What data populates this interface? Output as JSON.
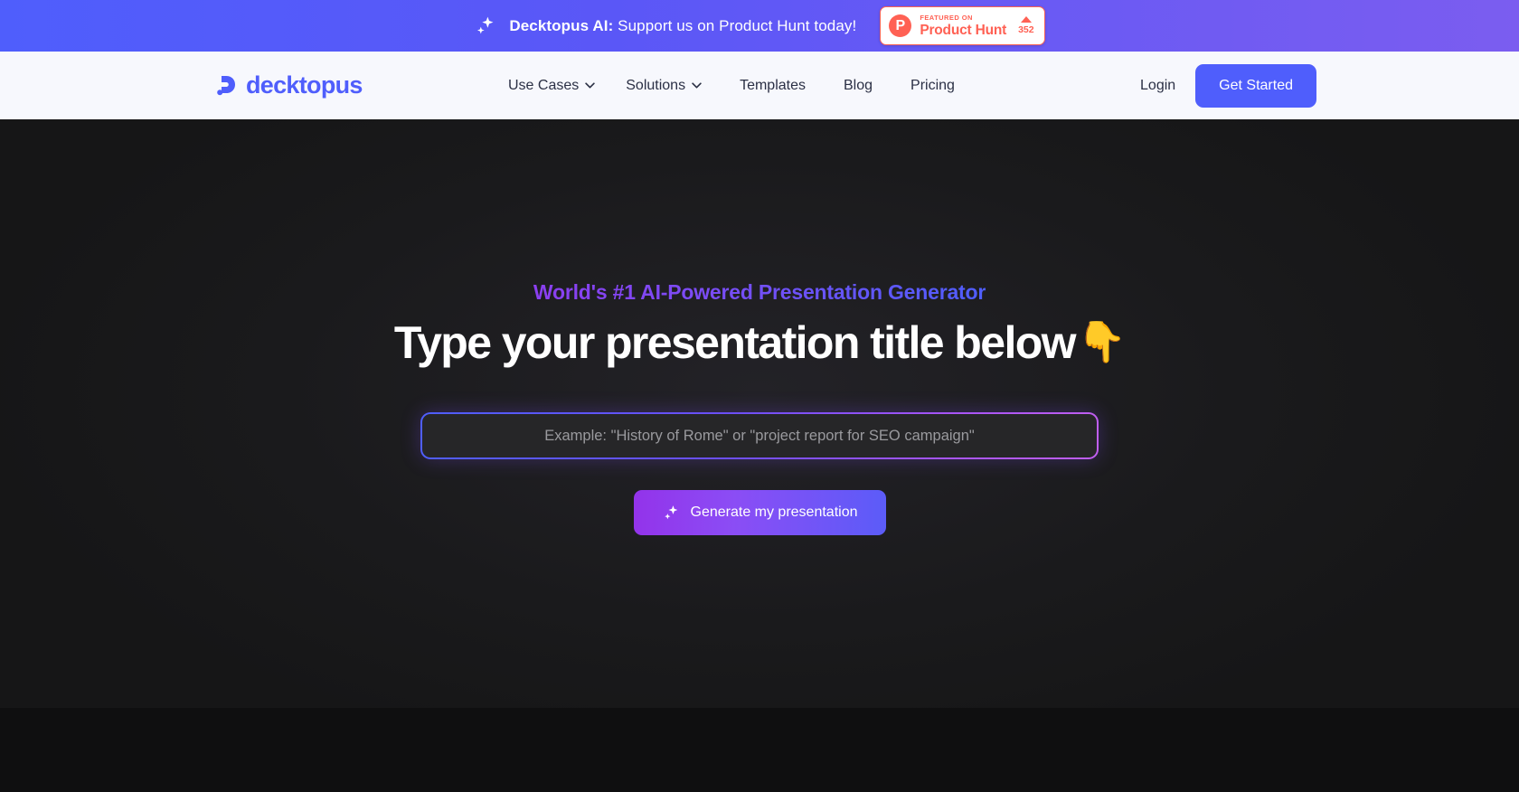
{
  "banner": {
    "sparkle_icon": "sparkle-icon",
    "brand": "Decktopus AI:",
    "message": "Support us on Product Hunt today!",
    "product_hunt": {
      "logo_letter": "P",
      "featured_label": "FEATURED ON",
      "name": "Product Hunt",
      "upvote_icon": "triangle-up-icon",
      "upvote_count": "352",
      "accent_color": "#ff6154"
    },
    "background_color": "#5a57f7"
  },
  "nav": {
    "logo": {
      "icon": "decktopus-logo-icon",
      "text": "decktopus",
      "color": "#4f5efc"
    },
    "links": [
      {
        "label": "Use Cases",
        "has_dropdown": true
      },
      {
        "label": "Solutions",
        "has_dropdown": true
      },
      {
        "label": "Templates",
        "has_dropdown": false
      },
      {
        "label": "Blog",
        "has_dropdown": false
      },
      {
        "label": "Pricing",
        "has_dropdown": false
      }
    ],
    "login_label": "Login",
    "get_started_label": "Get Started",
    "background_color": "#f7f8fd",
    "button_color": "#4f5efc"
  },
  "hero": {
    "eyebrow": "World's #1 AI-Powered Presentation Generator",
    "headline": "Type your presentation title below",
    "headline_emoji": "👇",
    "input": {
      "value": "",
      "placeholder": "Example: \"History of Rome\" or \"project report for SEO campaign\""
    },
    "cta": {
      "icon": "sparkle-icon",
      "label": "Generate my presentation"
    },
    "background_color": "#1a1a1c",
    "eyebrow_gradient": [
      "#8b3ff0",
      "#4f5efc"
    ],
    "cta_gradient": [
      "#9333ea",
      "#5b5cf8"
    ]
  }
}
